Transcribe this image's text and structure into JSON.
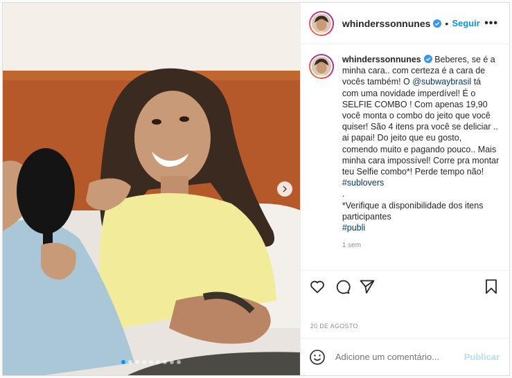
{
  "post": {
    "username": "whinderssonnunes",
    "follow_label": "Seguir",
    "separator": "•",
    "more_label": "•••",
    "caption": {
      "part1": " Beberes, se é a minha cara.. com certeza é a cara de vocês também! O ",
      "mention": "@subwaybrasil",
      "part2": " tá com uma novidade imperdível! É o SELFIE COMBO ! Com apenas 19,90 você monta o combo do jeito que você quiser! São 4 itens pra você se deliciar .. ai papai! Do jeito que eu gosto, comendo muito e pagando pouco.. Mais minha cara impossível! Corre pra montar teu Selfie combo*! Perde tempo não! ",
      "hashtag1": "#sublovers",
      "dot_line": ".",
      "note": "*Verifique a disponibilidade dos itens participantes",
      "hashtag2": "#publi"
    },
    "time_ago": "1 sem",
    "date": "20 DE AGOSTO",
    "comment_placeholder": "Adicione um comentário...",
    "publish_label": "Publicar",
    "carousel": {
      "count": 9,
      "active": 0
    }
  },
  "icons": {
    "verified": "verified-badge-icon",
    "like": "heart-icon",
    "comment": "comment-icon",
    "share": "paper-plane-icon",
    "save": "bookmark-icon",
    "emoji": "smiley-icon",
    "next": "chevron-right-icon"
  },
  "colors": {
    "link": "#0095f6",
    "mention": "#00376b",
    "muted": "#8e8e8e",
    "publish_disabled": "#b2dffc"
  }
}
